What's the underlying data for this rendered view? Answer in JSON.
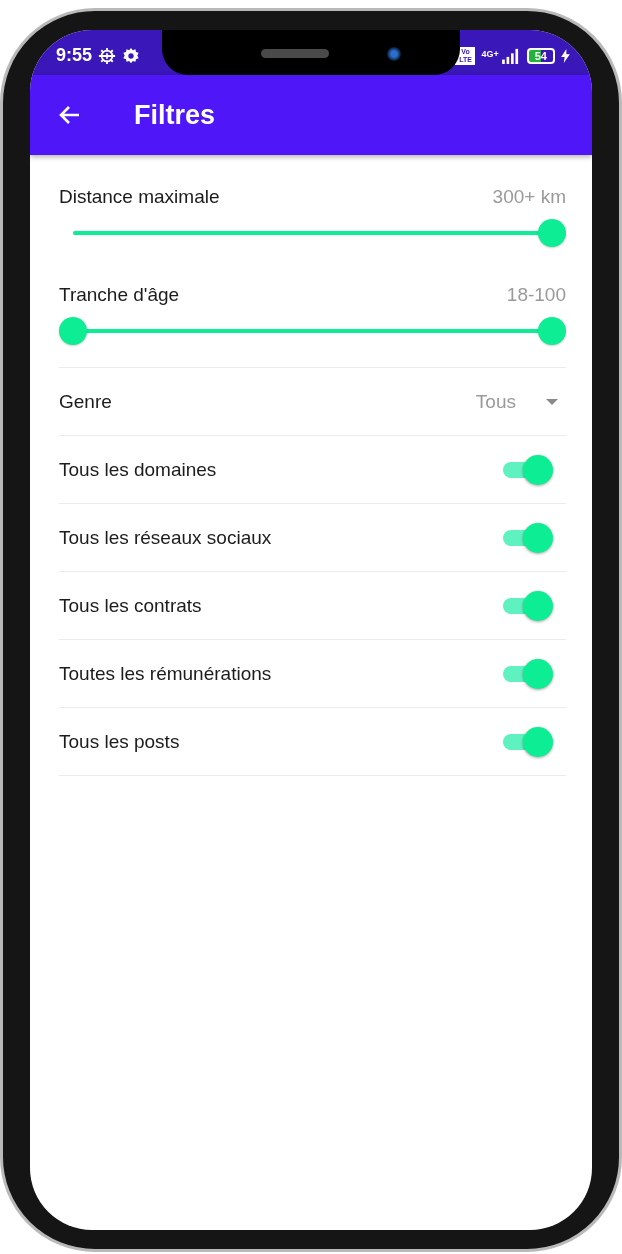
{
  "status_bar": {
    "time": "9:55",
    "volte": "Vo LTE",
    "network": "4G+",
    "battery": "54"
  },
  "app_bar": {
    "title": "Filtres"
  },
  "distance": {
    "label": "Distance maximale",
    "reading": "300+ km",
    "level": 1
  },
  "age": {
    "label": "Tranche d'âge",
    "reading": "18-100",
    "thumbs": [
      {
        "level": 0
      },
      {
        "level": 1
      }
    ]
  },
  "genre": {
    "label": "Genre",
    "value": "Tous"
  },
  "toggles": [
    {
      "label": "Tous les domaines",
      "on": true
    },
    {
      "label": "Tous les réseaux sociaux",
      "on": true
    },
    {
      "label": "Tous les contrats",
      "on": true
    },
    {
      "label": "Toutes les rémunérations",
      "on": true
    },
    {
      "label": "Tous les posts",
      "on": true
    }
  ]
}
